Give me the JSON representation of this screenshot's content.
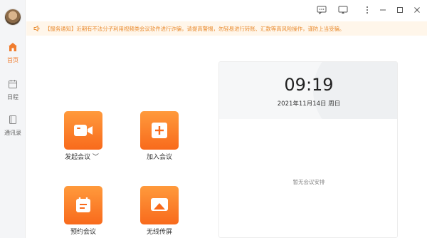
{
  "sidebar": {
    "items": [
      {
        "label": "首页",
        "icon": "home-icon",
        "active": true
      },
      {
        "label": "日程",
        "icon": "calendar-icon",
        "active": false
      },
      {
        "label": "通讯录",
        "icon": "contacts-icon",
        "active": false
      }
    ]
  },
  "notice": {
    "text": "【服务通知】近期有不法分子利用视频类会议软件进行诈骗，请提高警惕，勿轻易进行转账、汇款等高风险操作，谨防上当受骗。",
    "icon": "speaker-icon"
  },
  "actions": [
    {
      "label": "发起会议 ﹀",
      "icon": "video-camera-icon"
    },
    {
      "label": "加入会议",
      "icon": "plus-square-icon"
    },
    {
      "label": "预约会议",
      "icon": "calendar-icon"
    },
    {
      "label": "无线传屏",
      "icon": "screen-cast-icon"
    }
  ],
  "schedule": {
    "time": "09:19",
    "date": "2021年11月14日 周日",
    "empty_text": "暂无会议安排"
  },
  "colors": {
    "accent": "#f07c2e",
    "notice_bg": "#fff6ea",
    "notice_text": "#e98a2d"
  }
}
